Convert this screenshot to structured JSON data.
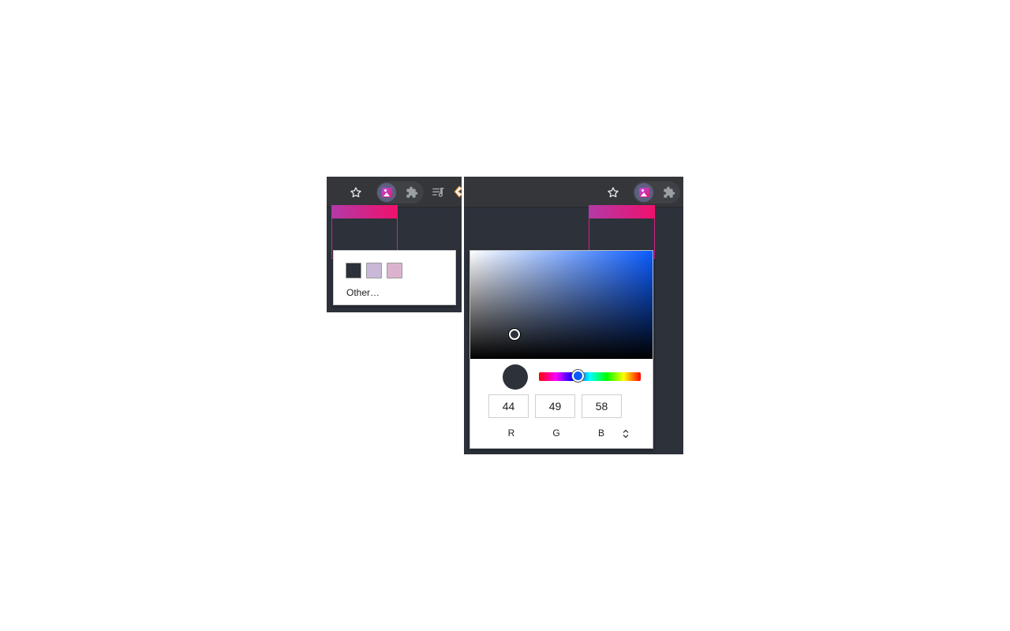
{
  "left_panel": {
    "toolbar_icons": [
      "star-icon",
      "image-extension-icon",
      "puzzle-extension-icon",
      "media-queue-icon",
      "partial-extension-icon"
    ],
    "menu": {
      "swatches": [
        {
          "name": "swatch-dark",
          "color": "#2c313a"
        },
        {
          "name": "swatch-lavender",
          "color": "#c9b8d8"
        },
        {
          "name": "swatch-pink",
          "color": "#dcb3cf"
        }
      ],
      "other_label": "Other…"
    }
  },
  "right_panel": {
    "toolbar_icons": [
      "star-icon",
      "image-extension-icon",
      "puzzle-extension-icon"
    ],
    "color_picker": {
      "current_color": "#2c313a",
      "hue_color": "#0a5bff",
      "hue_fraction": 0.38,
      "r_value": "44",
      "g_value": "49",
      "b_value": "58",
      "r_label": "R",
      "g_label": "G",
      "b_label": "B",
      "format_toggle_icon": "up-down-arrows-icon"
    }
  },
  "colors": {
    "toolbar_bg": "#35363a",
    "page_bg": "#2c313a",
    "accent_gradient_start": "#b23aa8",
    "accent_gradient_end": "#f0106c"
  }
}
